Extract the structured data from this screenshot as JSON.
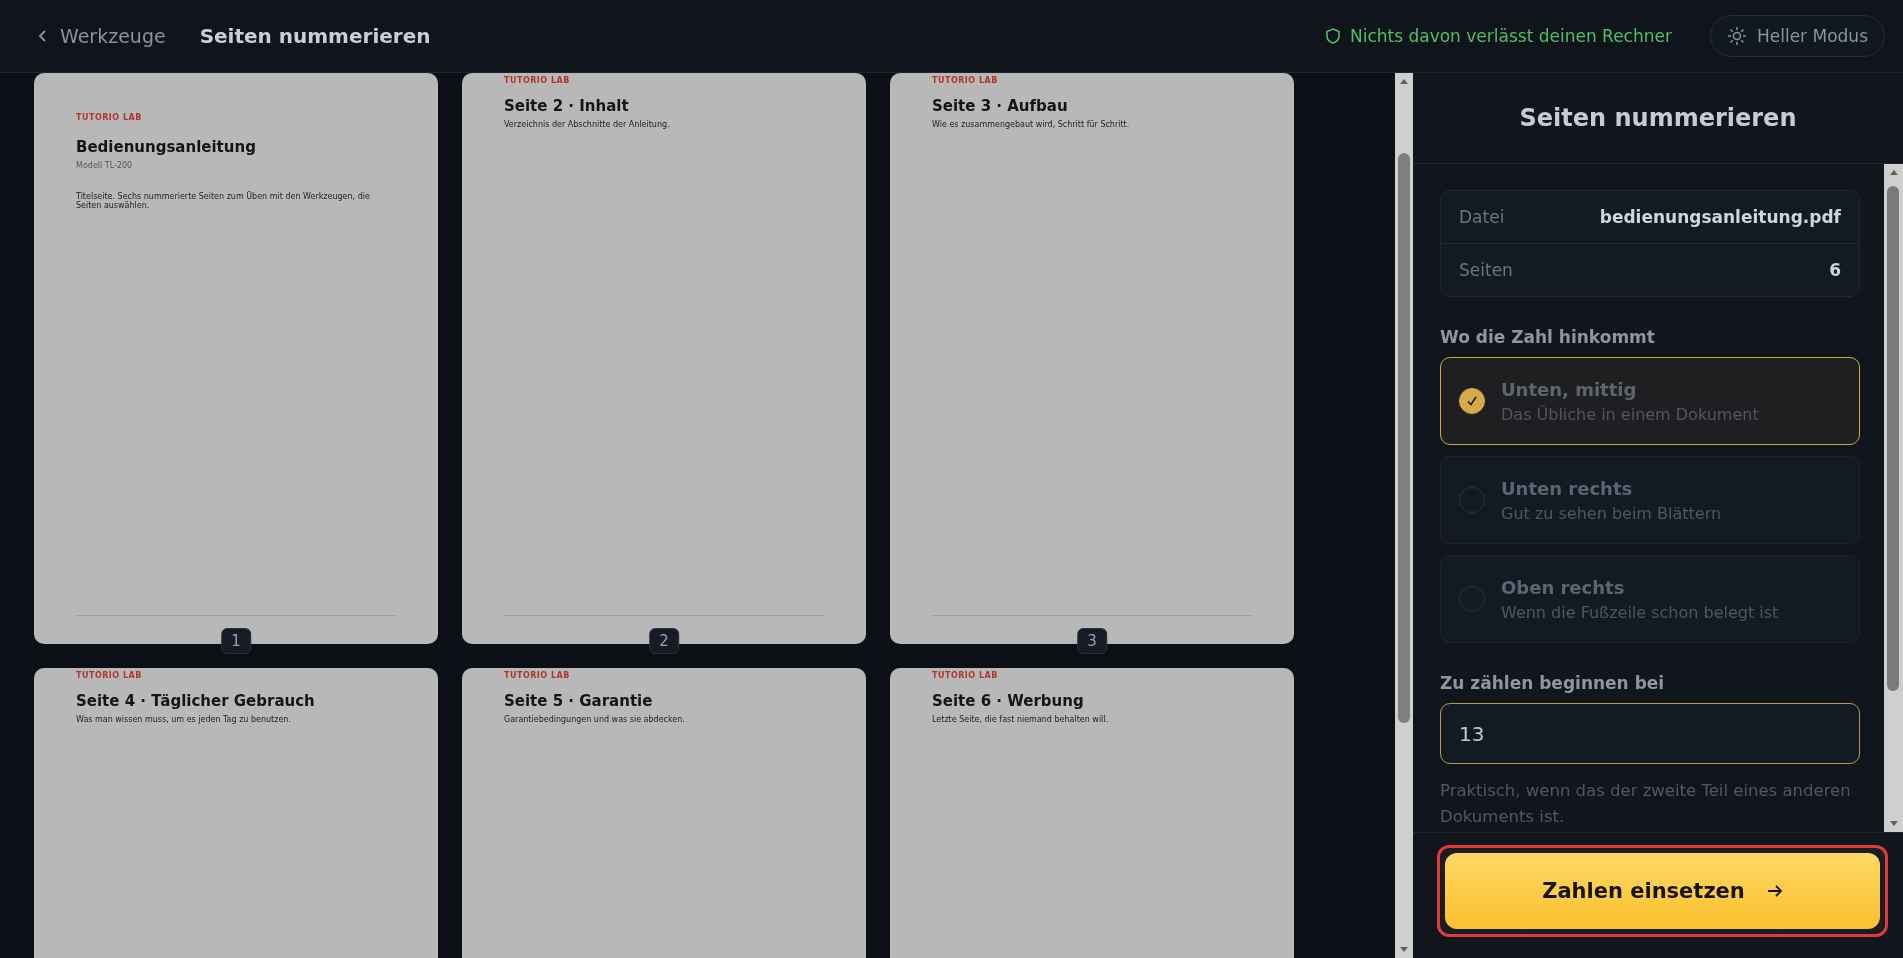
{
  "topbar": {
    "back_label": "Werkzeuge",
    "title": "Seiten nummerieren",
    "privacy_note": "Nichts davon verlässt deinen Rechner",
    "theme_button": "Heller Modus"
  },
  "pages": [
    {
      "kind": "cover",
      "brand": "TUTORIO LAB",
      "title": "Bedienungsanleitung",
      "subtitle": "Modell TL-200",
      "text": "Titelseite. Sechs nummerierte Seiten zum Üben mit den Werkzeugen, die Seiten auswählen.",
      "number": "1"
    },
    {
      "kind": "content",
      "brand": "TUTORIO LAB",
      "title": "Seite 2 · Inhalt",
      "text": "Verzeichnis der Abschnitte der Anleitung.",
      "number": "2"
    },
    {
      "kind": "content",
      "brand": "TUTORIO LAB",
      "title": "Seite 3 · Aufbau",
      "text": "Wie es zusammengebaut wird, Schritt für Schritt.",
      "number": "3"
    },
    {
      "kind": "content",
      "brand": "TUTORIO LAB",
      "title": "Seite 4 · Täglicher Gebrauch",
      "text": "Was man wissen muss, um es jeden Tag zu benutzen."
    },
    {
      "kind": "content",
      "brand": "TUTORIO LAB",
      "title": "Seite 5 · Garantie",
      "text": "Garantiebedingungen und was sie abdecken."
    },
    {
      "kind": "content",
      "brand": "TUTORIO LAB",
      "title": "Seite 6 · Werbung",
      "text": "Letzte Seite, die fast niemand behalten will."
    }
  ],
  "panel": {
    "title": "Seiten nummerieren",
    "file_info": [
      {
        "label": "Datei",
        "value": "bedienungsanleitung.pdf"
      },
      {
        "label": "Seiten",
        "value": "6"
      }
    ],
    "position_label": "Wo die Zahl hinkommt",
    "options": [
      {
        "title": "Unten, mittig",
        "description": "Das Übliche in einem Dokument",
        "selected": true
      },
      {
        "title": "Unten rechts",
        "description": "Gut zu sehen beim Blättern",
        "selected": false
      },
      {
        "title": "Oben rechts",
        "description": "Wenn die Fußzeile schon belegt ist",
        "selected": false
      }
    ],
    "start_label": "Zu zählen beginnen bei",
    "start_value": "13",
    "hint": "Praktisch, wenn das der zweite Teil eines anderen Dokuments ist.",
    "submit_button": "Zahlen einsetzen"
  }
}
